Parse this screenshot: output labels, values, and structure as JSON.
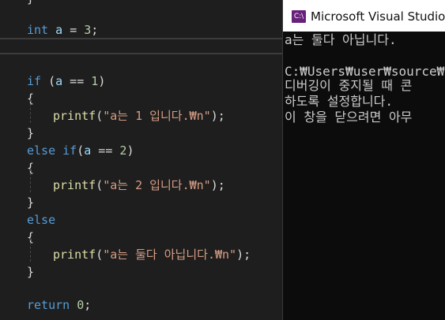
{
  "editor": {
    "line_top": "int a = 3;",
    "if_line": "if (a == 1)",
    "brace_open": "{",
    "brace_close": "}",
    "printf1": "printf(\"a는 1 입니다.₩n\");",
    "else_if_line": "else if(a == 2)",
    "printf2": "printf(\"a는 2 입니다.₩n\");",
    "else_line": "else",
    "printf3": "printf(\"a는 둘다 아닙니다.₩n\");",
    "return_line": "return 0;",
    "top_partial": "}"
  },
  "console": {
    "title": "Microsoft Visual Studio 디",
    "icon_label": "C:\\",
    "lines": [
      "a는 둘다 아닙니다.",
      "",
      "C:₩Users₩user₩source₩",
      "디버깅이 중지될 때 콘",
      "하도록 설정합니다.",
      "이 창을 닫으려면 아무"
    ]
  },
  "colors": {
    "keyword": "#569cd6",
    "variable": "#9cdcfe",
    "function": "#dcdcaa",
    "string": "#d69d85",
    "number": "#b5cea8",
    "console_bg": "#0c0c0c",
    "editor_bg": "#1e1e1e"
  }
}
